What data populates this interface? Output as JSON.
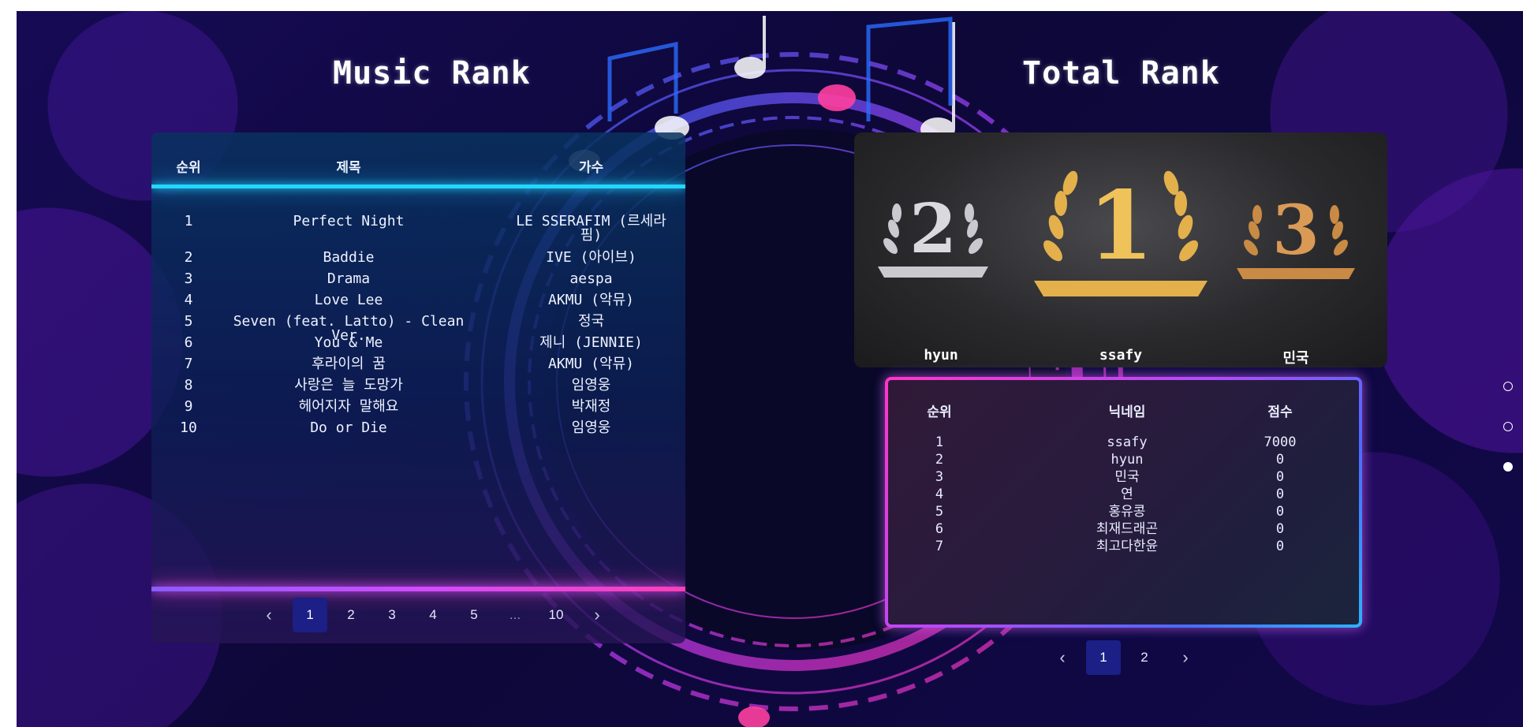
{
  "music_rank": {
    "title": "Music Rank",
    "headers": {
      "rank": "순위",
      "title": "제목",
      "artist": "가수"
    },
    "rows": [
      {
        "rank": "1",
        "title": "Perfect Night",
        "artist": "LE SSERAFIM (르세라핌)"
      },
      {
        "rank": "2",
        "title": "Baddie",
        "artist": "IVE (아이브)"
      },
      {
        "rank": "3",
        "title": "Drama",
        "artist": "aespa"
      },
      {
        "rank": "4",
        "title": "Love Lee",
        "artist": "AKMU (악뮤)"
      },
      {
        "rank": "5",
        "title": "Seven (feat. Latto) - Clean Ver.",
        "artist": "정국"
      },
      {
        "rank": "6",
        "title": "You & Me",
        "artist": "제니 (JENNIE)"
      },
      {
        "rank": "7",
        "title": "후라이의 꿈",
        "artist": "AKMU (악뮤)"
      },
      {
        "rank": "8",
        "title": "사랑은 늘 도망가",
        "artist": "임영웅"
      },
      {
        "rank": "9",
        "title": "헤어지자 말해요",
        "artist": "박재정"
      },
      {
        "rank": "10",
        "title": "Do or Die",
        "artist": "임영웅"
      }
    ],
    "pagination": {
      "prev": "‹",
      "pages": [
        "1",
        "2",
        "3",
        "4",
        "5",
        "...",
        "10"
      ],
      "active": "1",
      "next": "›"
    }
  },
  "total_rank": {
    "title": "Total Rank",
    "podium": [
      {
        "place": "2",
        "name": "hyun",
        "color": "#c9c9cf"
      },
      {
        "place": "1",
        "name": "ssafy",
        "color": "#e3b04b"
      },
      {
        "place": "3",
        "name": "민국",
        "color": "#c98a45"
      }
    ],
    "headers": {
      "rank": "순위",
      "nickname": "닉네임",
      "score": "점수"
    },
    "rows": [
      {
        "rank": "1",
        "nickname": "ssafy",
        "score": "7000"
      },
      {
        "rank": "2",
        "nickname": "hyun",
        "score": "0"
      },
      {
        "rank": "3",
        "nickname": "민국",
        "score": "0"
      },
      {
        "rank": "4",
        "nickname": "연",
        "score": "0"
      },
      {
        "rank": "5",
        "nickname": "홍유콩",
        "score": "0"
      },
      {
        "rank": "6",
        "nickname": "최재드래곤",
        "score": "0"
      },
      {
        "rank": "7",
        "nickname": "최고다한윤",
        "score": "0"
      }
    ],
    "pagination": {
      "prev": "‹",
      "pages": [
        "1",
        "2"
      ],
      "active": "1",
      "next": "›"
    }
  },
  "section_dots": {
    "count": 3,
    "active_index": 2
  },
  "colors": {
    "neon_cyan": "#22d6ff",
    "neon_pink": "#ff3fb4",
    "page_active": "#1b1f86",
    "gold": "#e3b04b",
    "silver": "#c9c9cf",
    "bronze": "#c98a45"
  }
}
